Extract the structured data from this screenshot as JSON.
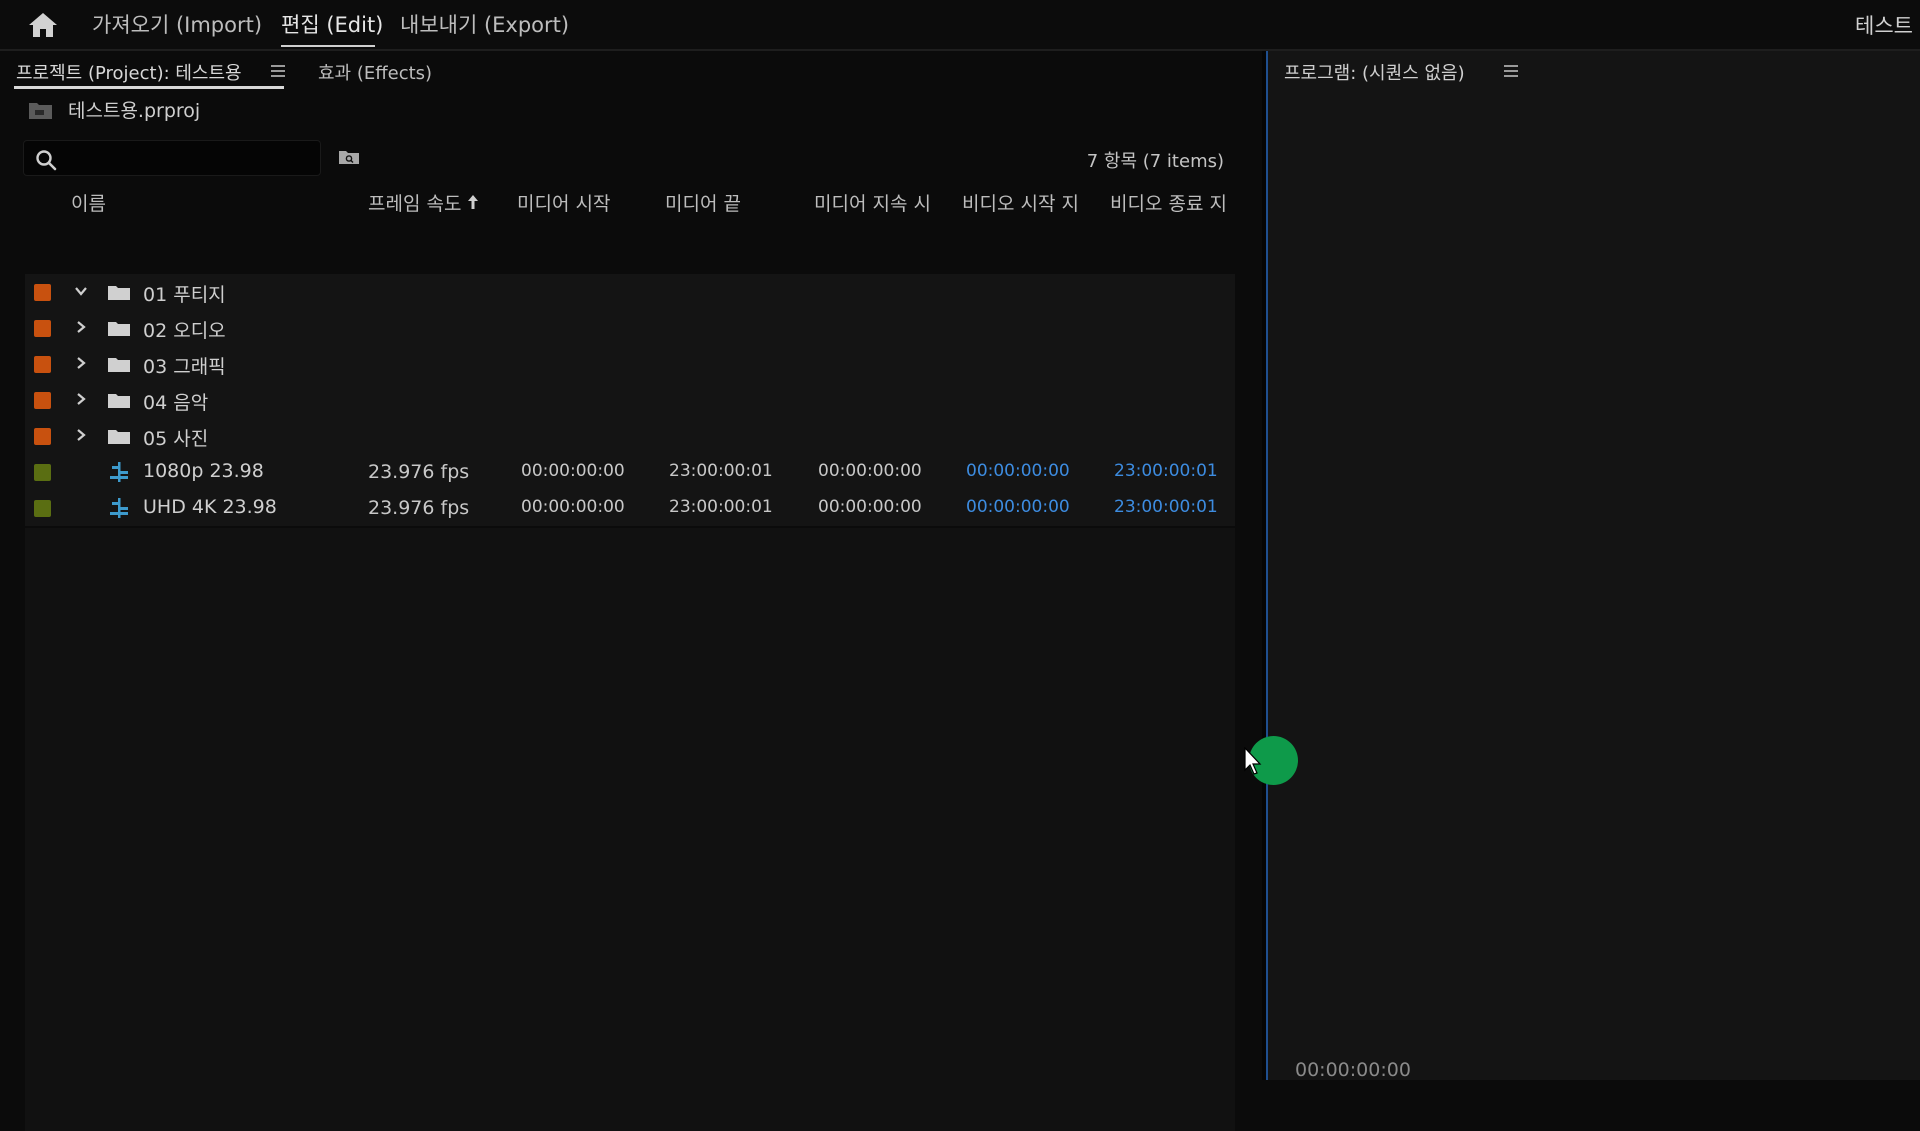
{
  "menu": {
    "import_label": "가져오기 (Import)",
    "edit_label": "편집 (Edit)",
    "export_label": "내보내기 (Export)",
    "workspace_title": "테스트"
  },
  "project_panel": {
    "tab_project": "프로젝트 (Project): 테스트용",
    "tab_effects": "효과 (Effects)",
    "project_file": "테스트용.prproj",
    "search": {
      "value": "",
      "placeholder": ""
    },
    "item_count": "7 항목 (7 items)",
    "columns": {
      "name": "이름",
      "frame_rate": "프레임 속도",
      "media_start": "미디어 시작",
      "media_end": "미디어 끝",
      "media_duration": "미디어 지속 시",
      "video_in": "비디오 시작 지",
      "video_out": "비디오 종료 지"
    },
    "rows": [
      {
        "type": "folder",
        "expanded": true,
        "label_color": "#c8510f",
        "name": "01 푸티지"
      },
      {
        "type": "folder",
        "expanded": false,
        "label_color": "#c8510f",
        "name": "02 오디오"
      },
      {
        "type": "folder",
        "expanded": false,
        "label_color": "#c8510f",
        "name": "03 그래픽"
      },
      {
        "type": "folder",
        "expanded": false,
        "label_color": "#c8510f",
        "name": "04 음악"
      },
      {
        "type": "folder",
        "expanded": false,
        "label_color": "#c8510f",
        "name": "05 사진"
      },
      {
        "type": "sequence",
        "label_color": "#5a6e12",
        "name": "1080p 23.98",
        "frame_rate": "23.976 fps",
        "media_start": "00:00:00:00",
        "media_end": "23:00:00:01",
        "media_duration": "00:00:00:00",
        "video_in": "00:00:00:00",
        "video_out": "23:00:00:01"
      },
      {
        "type": "sequence",
        "label_color": "#5a6e12",
        "name": "UHD 4K 23.98",
        "frame_rate": "23.976 fps",
        "media_start": "00:00:00:00",
        "media_end": "23:00:00:01",
        "media_duration": "00:00:00:00",
        "video_in": "00:00:00:00",
        "video_out": "23:00:00:01"
      }
    ]
  },
  "program_monitor": {
    "title": "프로그램: (시퀀스 없음)",
    "timecode": "00:00:00:00"
  },
  "colors": {
    "accent_blue": "#3d8ce0",
    "folder_label": "#c8510f",
    "sequence_label": "#5a6e12",
    "click_indicator": "#0e9a4a"
  }
}
